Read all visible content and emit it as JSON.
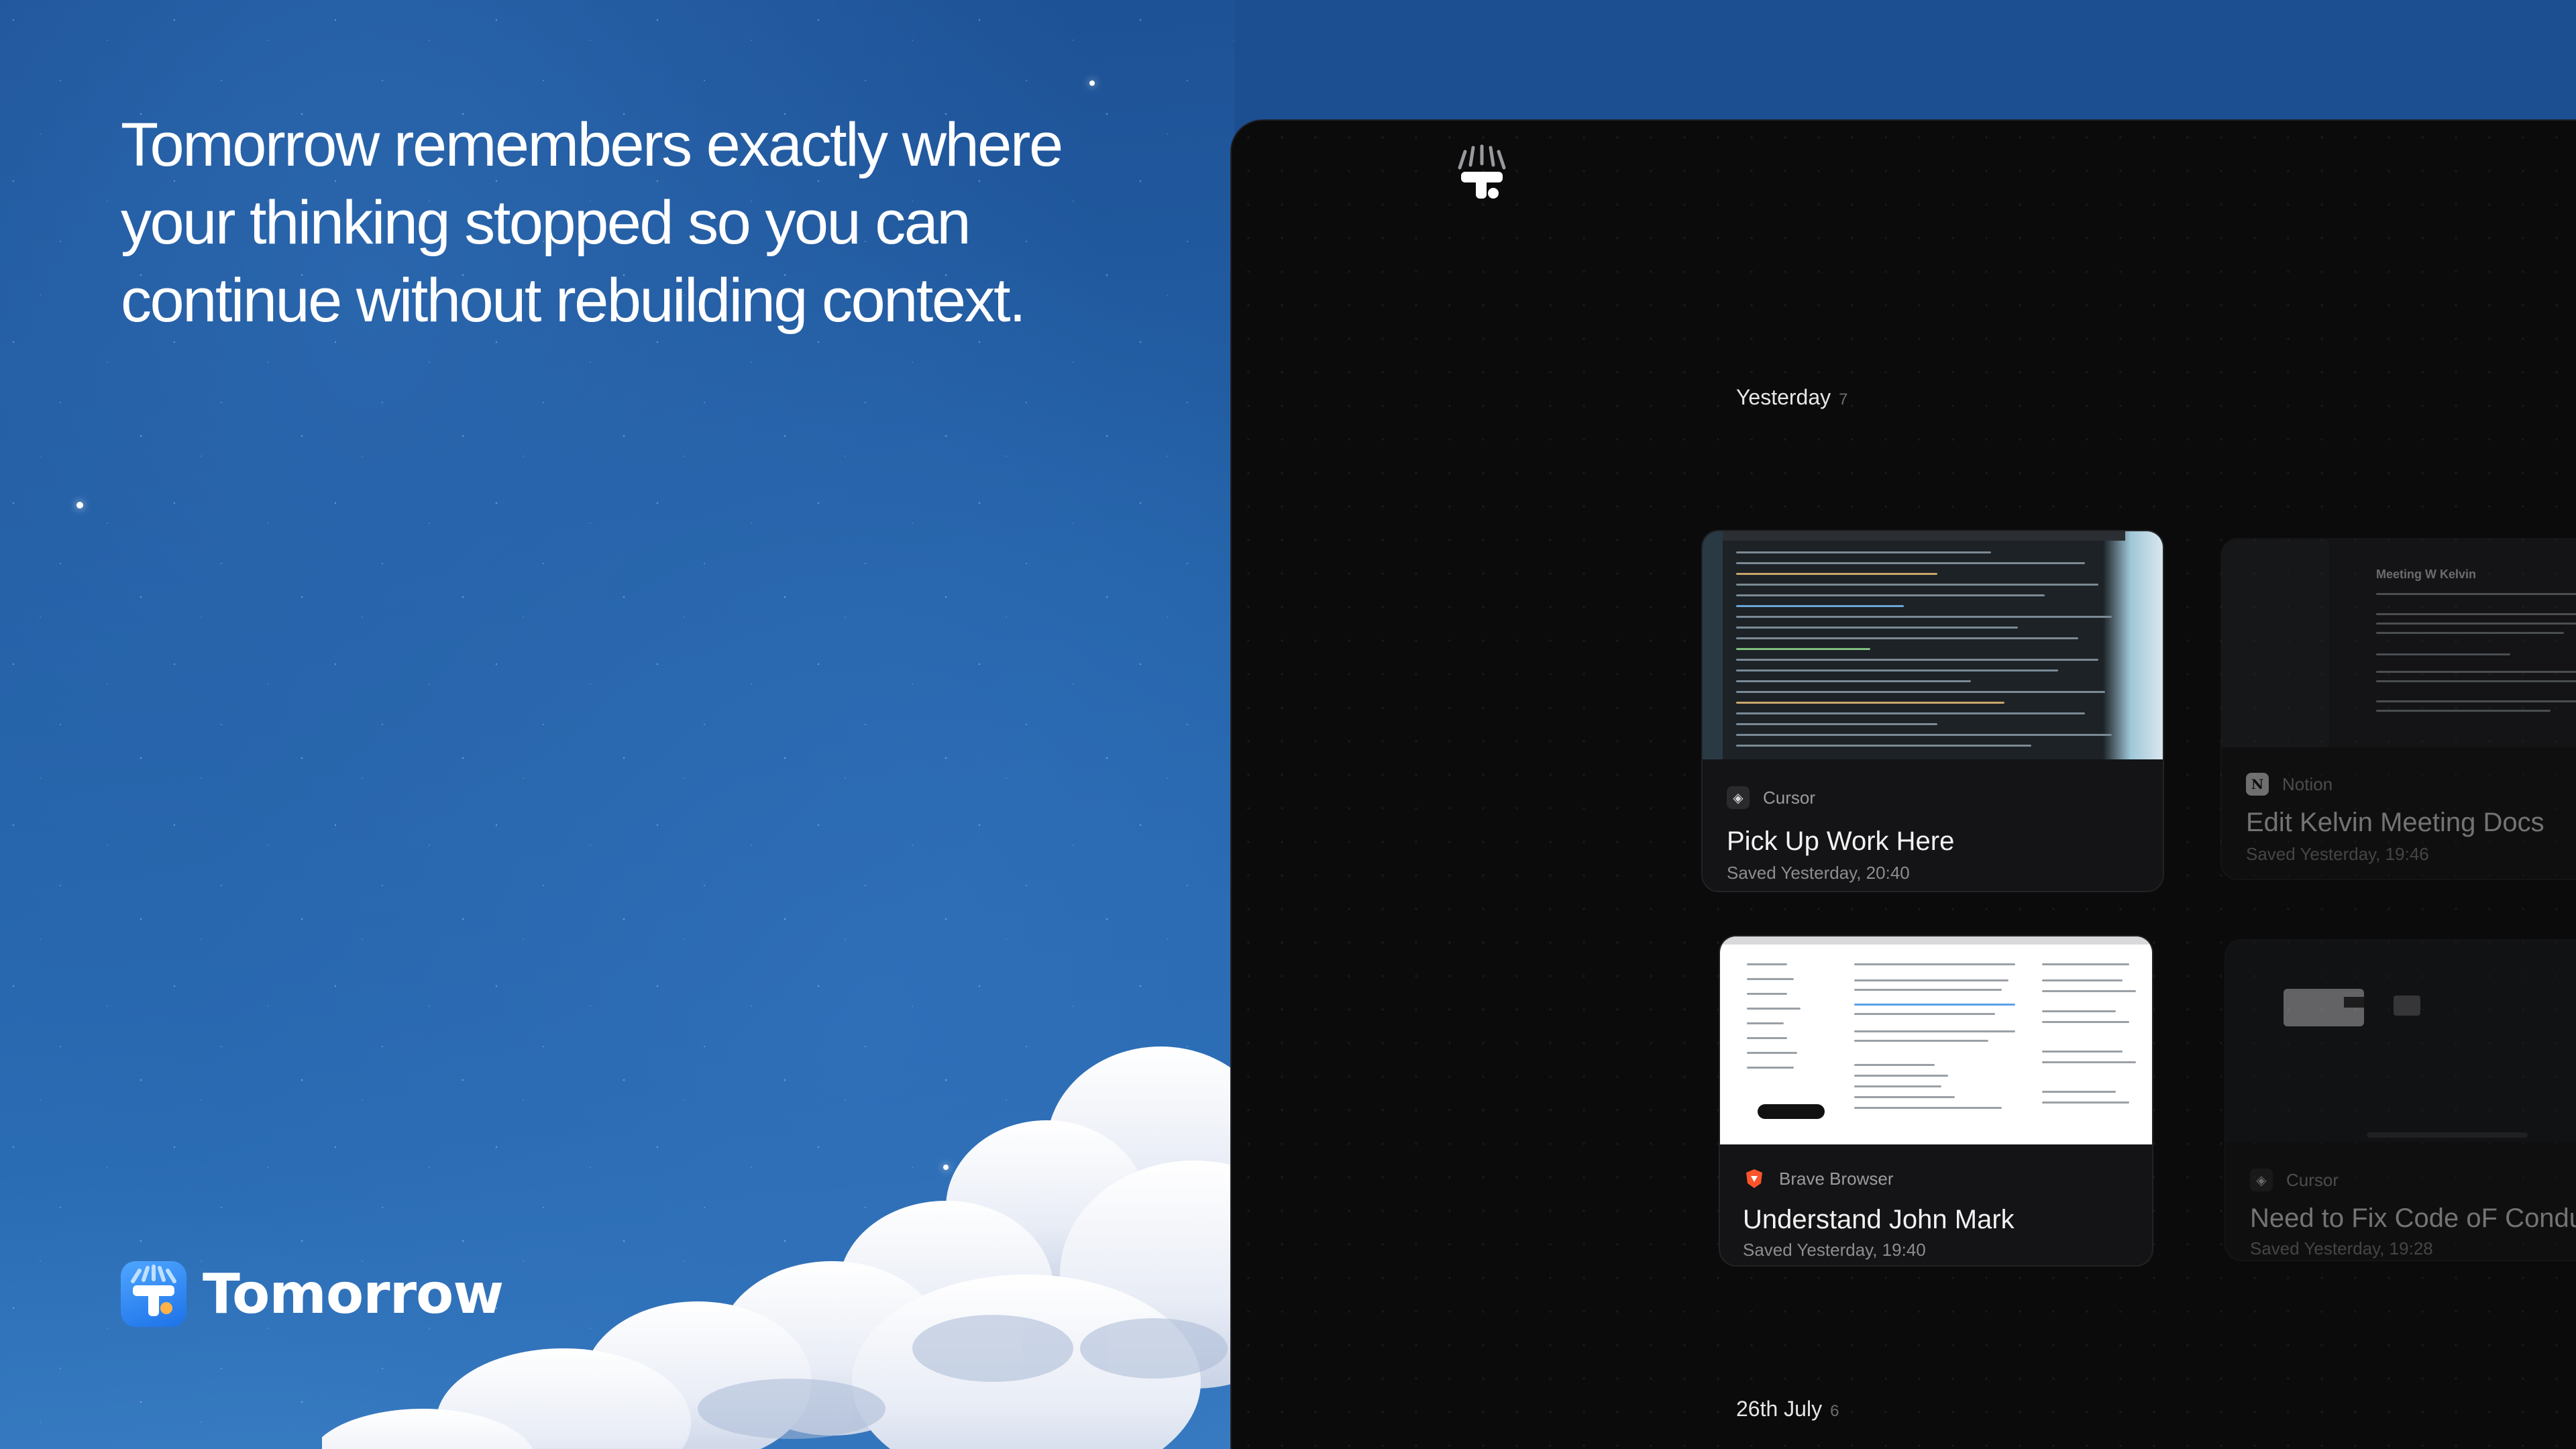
{
  "marketing": {
    "headline_lines": [
      "Tomorrow remembers exactly where",
      "your thinking stopped so you can",
      "continue without rebuilding context."
    ],
    "brand_name": "Tomorrow",
    "brand_logo_icon": "tomorrow-logo-icon"
  },
  "app": {
    "logo_icon": "tomorrow-t-logo-icon",
    "sections": [
      {
        "label": "Yesterday",
        "count": "7"
      },
      {
        "label": "26th July",
        "count": "6"
      }
    ],
    "cards": [
      {
        "app_name": "Cursor",
        "app_icon": "cursor-app-icon",
        "title": "Pick Up Work Here",
        "saved": "Saved Yesterday, 20:40"
      },
      {
        "app_name": "Notion",
        "app_icon": "notion-app-icon",
        "title": "Edit Kelvin Meeting Docs",
        "saved": "Saved Yesterday, 19:46",
        "thumb_heading": "Meeting W Kelvin"
      },
      {
        "app_name": "Brave Browser",
        "app_icon": "brave-app-icon",
        "title": "Understand John Mark",
        "saved": "Saved Yesterday, 19:40"
      },
      {
        "app_name": "Cursor",
        "app_icon": "cursor-app-icon",
        "title": "Need to Fix Code oF Conduct",
        "saved": "Saved Yesterday, 19:28"
      }
    ]
  }
}
